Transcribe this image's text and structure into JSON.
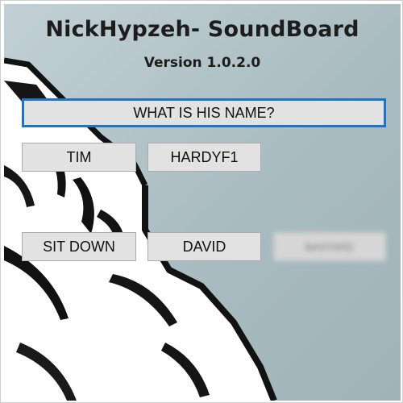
{
  "app": {
    "title": "NickHypzeh- SoundBoard",
    "version": "Version 1.0.2.0"
  },
  "buttons": {
    "what_is_his_name": "WHAT IS HIS NAME?",
    "tim": "TIM",
    "hardyf1": "HARDYF1",
    "sit_down": "SIT DOWN",
    "david": "DAVID",
    "censored": "BASTARD"
  },
  "colors": {
    "background": "#a9bcc1",
    "button_face": "#e2e2e2",
    "focus_border": "#1d73c8"
  }
}
